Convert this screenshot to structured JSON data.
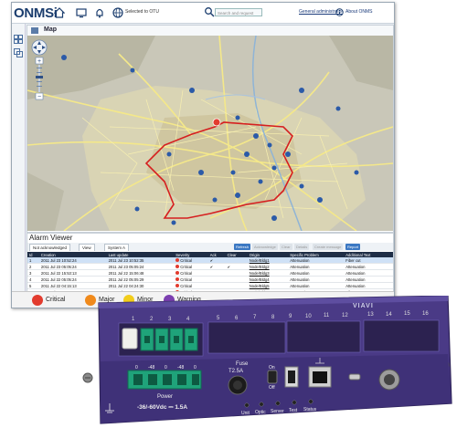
{
  "app": {
    "logo": "ONMSi",
    "connection": "Selected to OTU",
    "search_placeholder": "Search and request",
    "admin_link": "General administrator",
    "about": "About ONMS"
  },
  "map": {
    "title": "Map",
    "zoom_plus": "+",
    "zoom_minus": "−"
  },
  "alarm_viewer": {
    "title": "Alarm Viewer",
    "tabs": [
      "Not acknowledged",
      "View",
      "System A"
    ],
    "actions": [
      "Refresh",
      "Acknowledge",
      "Clear",
      "Details",
      "Create message",
      "Report"
    ],
    "columns": [
      "Id",
      "Creation",
      "Last update",
      "Severity",
      "Ack",
      "Clear",
      "Origin",
      "Specific Problem",
      "Additional Text"
    ],
    "rows": [
      {
        "id": "1",
        "creation": "2011 Jul 23 10:52:24",
        "last": "2011 Jul 23 10:52:35",
        "severity": "Critical",
        "ack": "✔",
        "clear": "",
        "origin": "Node/Bldg1",
        "problem": "Attenuation",
        "text": "Fiber cut"
      },
      {
        "id": "2",
        "creation": "2011 Jul 23 05:05:24",
        "last": "2011 Jul 23 05:05:24",
        "severity": "Critical",
        "ack": "✔",
        "clear": "✔",
        "origin": "Node/Bldg2",
        "problem": "Attenuation",
        "text": "Attenuation"
      },
      {
        "id": "3",
        "creation": "2011 Jul 22 15:53:13",
        "last": "2011 Jul 22 15:06:48",
        "severity": "Critical",
        "ack": "",
        "clear": "",
        "origin": "Node/Bldg3",
        "problem": "Attenuation",
        "text": "Attenuation"
      },
      {
        "id": "4",
        "creation": "2011 Jul 22 05:05:24",
        "last": "2011 Jul 22 05:05:29",
        "severity": "Critical",
        "ack": "",
        "clear": "",
        "origin": "Node/Bldg4",
        "problem": "Attenuation",
        "text": "Attenuation"
      },
      {
        "id": "5",
        "creation": "2011 Jul 22 04:15:13",
        "last": "2011 Jul 22 04:24:30",
        "severity": "Critical",
        "ack": "",
        "clear": "",
        "origin": "Node/Bldg5",
        "problem": "Attenuation",
        "text": "Attenuation"
      },
      {
        "id": "6",
        "creation": "2011 Jul 21 13:52:13",
        "last": "2011 Jul 21 13:52:23",
        "severity": "Critical",
        "ack": "",
        "clear": "",
        "origin": "Node/Bldg6",
        "problem": "Attenuation",
        "text": "Fiber cut"
      }
    ],
    "pager": "Page 1 of 1"
  },
  "legend": [
    {
      "label": "Critical",
      "color": "#e23b2e"
    },
    {
      "label": "Major",
      "color": "#f08a1c"
    },
    {
      "label": "Minor",
      "color": "#f2cd1b"
    },
    {
      "label": "Warning",
      "color": "#7b3fb0"
    }
  ],
  "hardware": {
    "brand": "VIAVI",
    "slot_numbers": [
      "1",
      "2",
      "3",
      "4",
      "5",
      "6",
      "7",
      "8",
      "9",
      "10",
      "11",
      "12",
      "13",
      "14",
      "15",
      "16"
    ],
    "power_label": "Power",
    "power_spec": "-36/-60Vdc ⎓ 1.5A",
    "terminal_labels": [
      "0",
      "-48",
      "0",
      "-48",
      "0"
    ],
    "fuse_label": "Fuse",
    "fuse_rating": "T2.5A",
    "on_label": "On",
    "off_label": "Off",
    "led_labels": [
      "Unit",
      "Optic",
      "Server",
      "Test",
      "Status"
    ],
    "colors": {
      "body": "#4a3a86",
      "connector": "#1fa37a"
    }
  }
}
